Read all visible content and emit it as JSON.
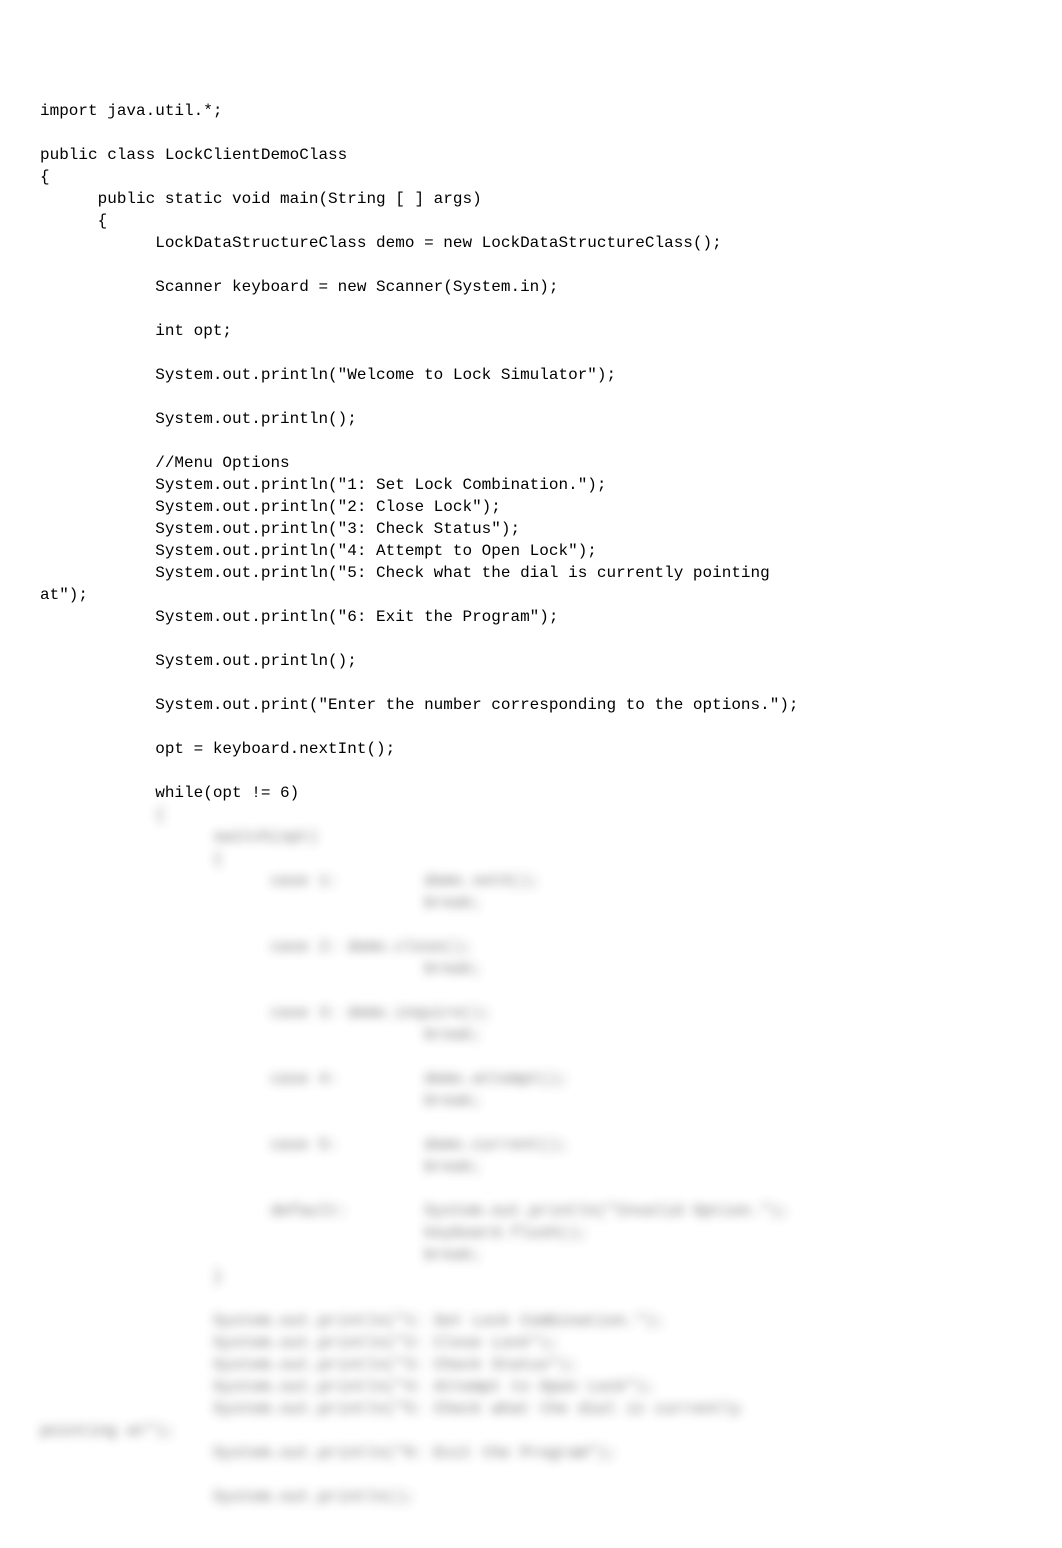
{
  "code": {
    "clear_lines": [
      "import java.util.*;",
      "",
      "public class LockClientDemoClass",
      "{",
      "      public static void main(String [ ] args)",
      "      {",
      "            LockDataStructureClass demo = new LockDataStructureClass();",
      "",
      "            Scanner keyboard = new Scanner(System.in);",
      "",
      "            int opt;",
      "",
      "            System.out.println(\"Welcome to Lock Simulator\");",
      "",
      "            System.out.println();",
      "",
      "            //Menu Options",
      "            System.out.println(\"1: Set Lock Combination.\");",
      "            System.out.println(\"2: Close Lock\");",
      "            System.out.println(\"3: Check Status\");",
      "            System.out.println(\"4: Attempt to Open Lock\");",
      "            System.out.println(\"5: Check what the dial is currently pointing",
      "at\");",
      "            System.out.println(\"6: Exit the Program\");",
      "",
      "            System.out.println();",
      "",
      "            System.out.print(\"Enter the number corresponding to the options.\");",
      "",
      "            opt = keyboard.nextInt();",
      "",
      "            while(opt != 6)"
    ],
    "blurred_lines": [
      "            {",
      "                  switch(opt)",
      "                  {",
      "                        case 1:         demo.setX();",
      "                                        break;",
      "",
      "                        case 2: demo.close();",
      "                                        break;",
      "",
      "                        case 3: demo.inquire();",
      "                                        break;",
      "",
      "                        case 4:         demo.attempt();",
      "                                        break;",
      "",
      "                        case 5:         demo.current();",
      "                                        break;",
      "",
      "                        default:        System.out.println(\"Invalid Option.\");",
      "                                        keyboard.flush();",
      "                                        break;",
      "                  }",
      "",
      "                  System.out.println(\"1: Set Lock Combination.\");",
      "                  System.out.println(\"2: Close Lock\");",
      "                  System.out.println(\"3: Check Status\");",
      "                  System.out.println(\"4: Attempt to Open Lock\");",
      "                  System.out.println(\"5: Check what the dial is currently",
      "pointing at\");",
      "                  System.out.println(\"6: Exit the Program\");",
      "",
      "                  System.out.println();",
      ""
    ]
  }
}
